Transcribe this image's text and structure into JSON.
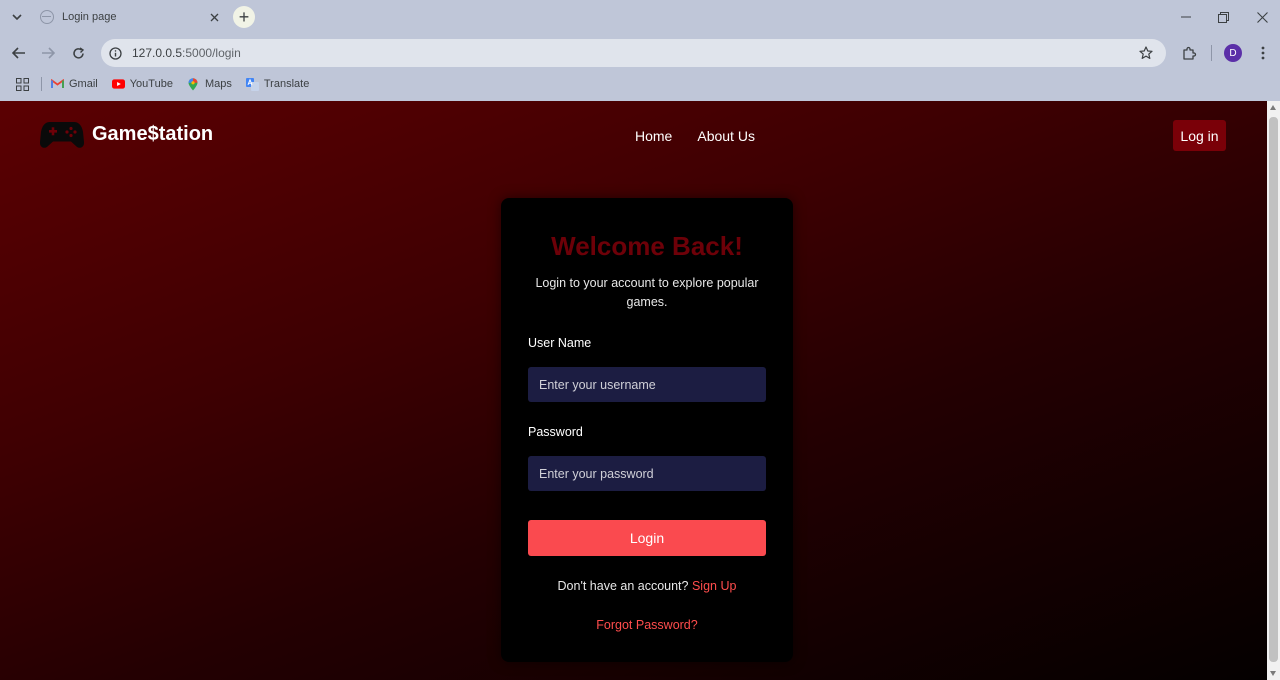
{
  "browser": {
    "tab": {
      "title": "Login page"
    },
    "new_tab_symbol": "+",
    "address": {
      "host": "127.0.0.5",
      "path": ":5000/login"
    },
    "profile_initial": "D",
    "bookmarks": [
      {
        "label": "Gmail",
        "icon": "gmail-icon"
      },
      {
        "label": "YouTube",
        "icon": "youtube-icon"
      },
      {
        "label": "Maps",
        "icon": "maps-icon"
      },
      {
        "label": "Translate",
        "icon": "translate-icon"
      }
    ]
  },
  "site": {
    "brand": "Game$tation",
    "logo_icon": "gamepad-icon",
    "nav": [
      {
        "label": "Home"
      },
      {
        "label": "About Us"
      }
    ],
    "login_button": "Log in",
    "accent_color": "#7a0008"
  },
  "login_card": {
    "heading": "Welcome Back!",
    "subtitle": "Login to your account to explore popular games.",
    "username": {
      "label": "User Name",
      "placeholder": "Enter your username",
      "value": ""
    },
    "password": {
      "label": "Password",
      "placeholder": "Enter your password",
      "value": ""
    },
    "submit_label": "Login",
    "submit_color": "#fa4a4f",
    "signup_prompt": "Don't have an account?",
    "signup_link": "Sign Up",
    "forgot_link": "Forgot Password?"
  }
}
